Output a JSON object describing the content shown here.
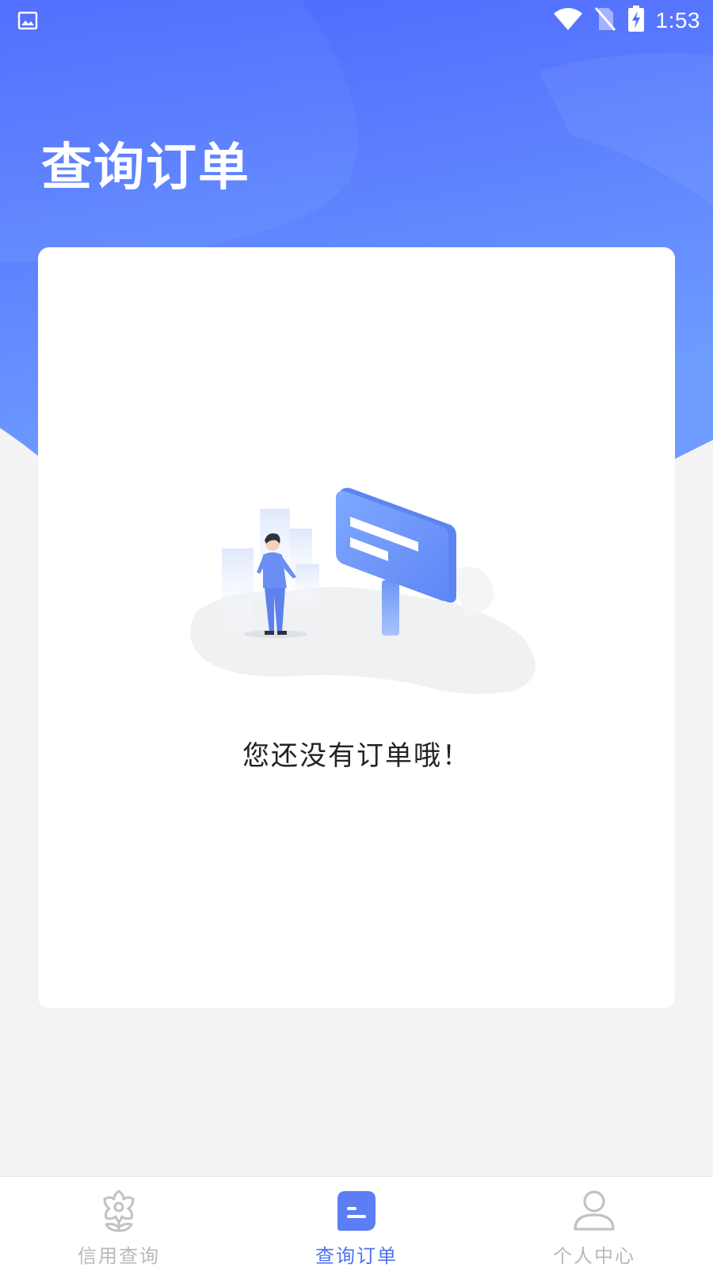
{
  "status_bar": {
    "time": "1:53",
    "icons": [
      "image-icon",
      "wifi-icon",
      "no-sim-icon",
      "battery-charging-icon"
    ]
  },
  "header": {
    "title": "查询订单"
  },
  "empty_state": {
    "message": "您还没有订单哦！",
    "illustration": "person-with-message-sign"
  },
  "bottom_nav": {
    "items": [
      {
        "label": "信用查询",
        "icon": "flower-icon",
        "active": false
      },
      {
        "label": "查询订单",
        "icon": "order-icon",
        "active": true
      },
      {
        "label": "个人中心",
        "icon": "user-icon",
        "active": false
      }
    ]
  },
  "colors": {
    "accent": "#4f72f3",
    "gradient_top": "#4f6bff",
    "gradient_bottom": "#79a6ff",
    "inactive": "#b9b9bd"
  }
}
